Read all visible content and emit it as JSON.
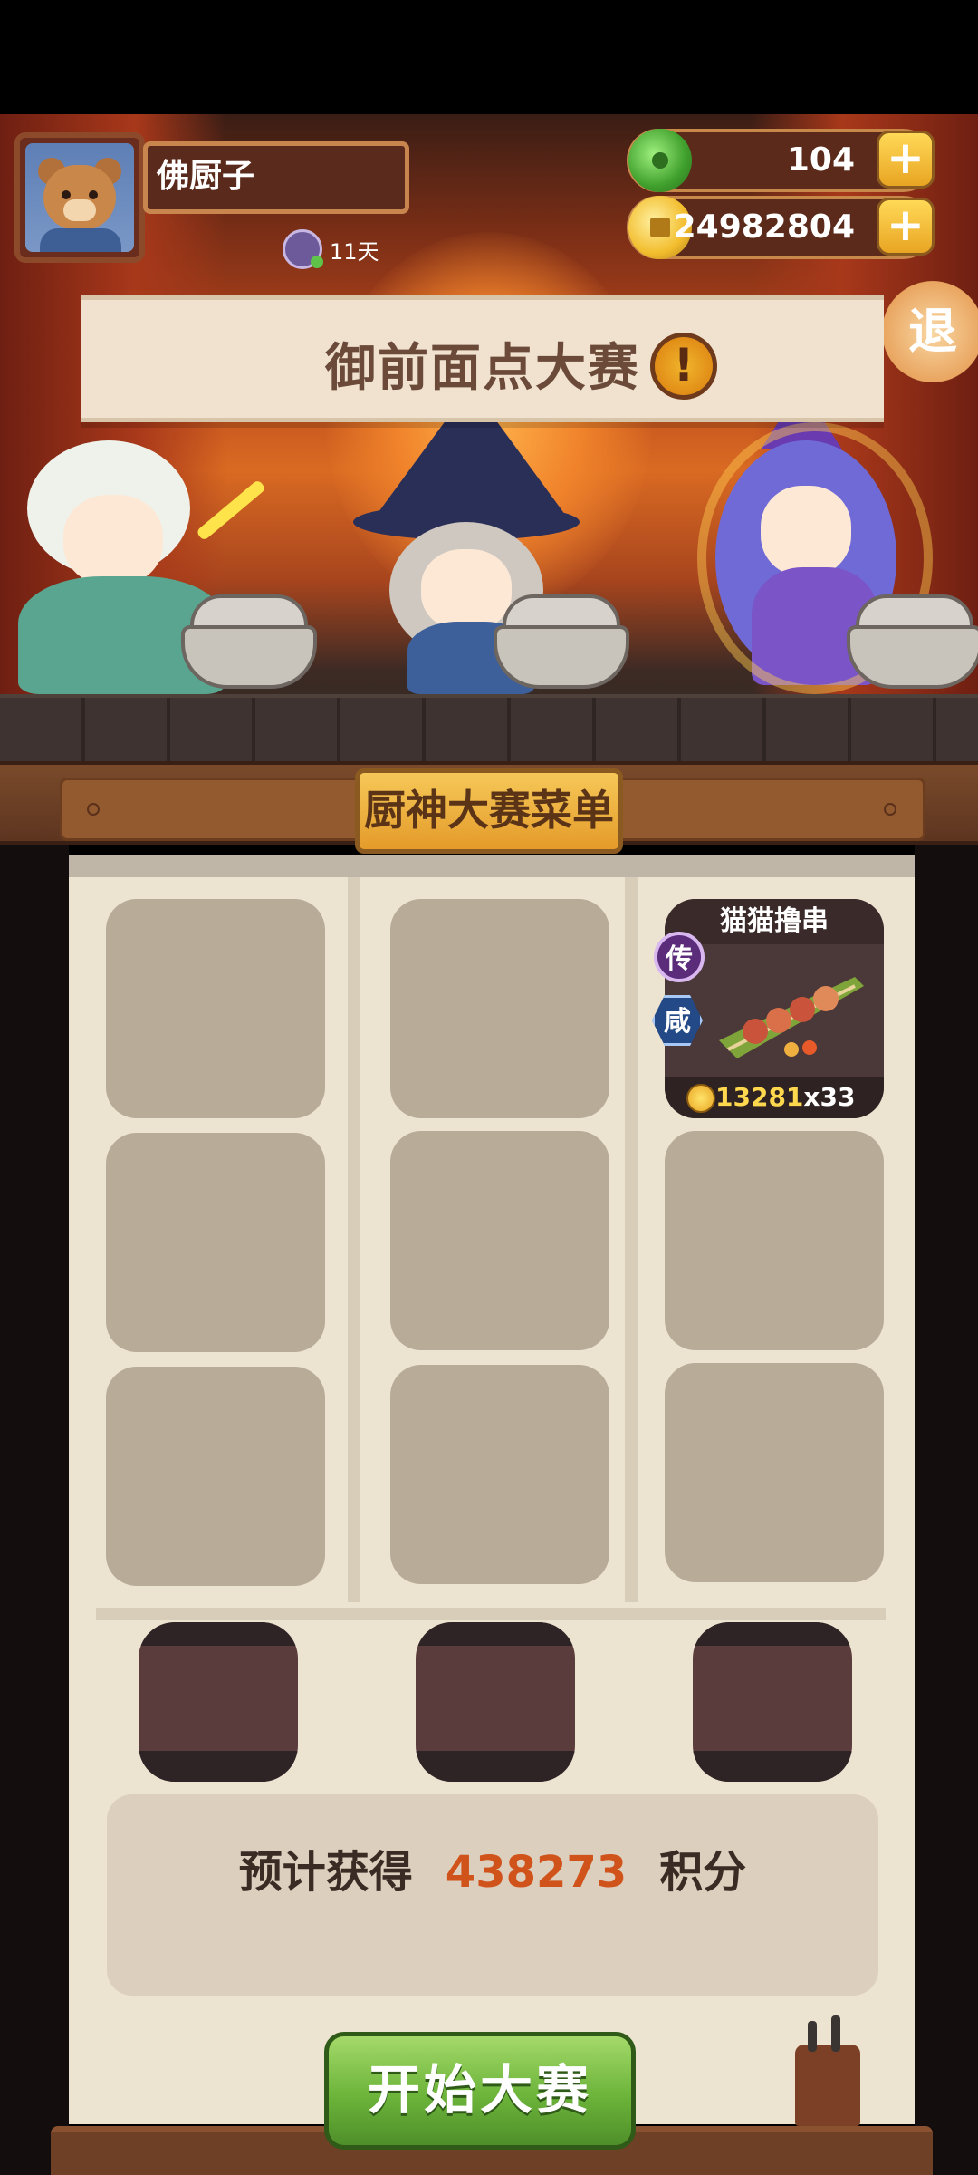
{
  "header": {
    "player_name": "佛厨子",
    "days_label": "11天",
    "jade_value": "104",
    "gold_value": "24982804",
    "plus_label": "+",
    "exit_label": "退"
  },
  "banner": {
    "title": "御前面点大赛",
    "alert_label": "!"
  },
  "menu": {
    "title": "厨神大赛菜单",
    "dish": {
      "name": "猫猫撸串",
      "rarity_tag": "传",
      "flavor_tag": "咸",
      "price": "13281",
      "count": "x33"
    }
  },
  "score": {
    "prefix": "预计获得",
    "value": "438273",
    "suffix": "积分"
  },
  "start_button": {
    "label": "开始大赛"
  }
}
